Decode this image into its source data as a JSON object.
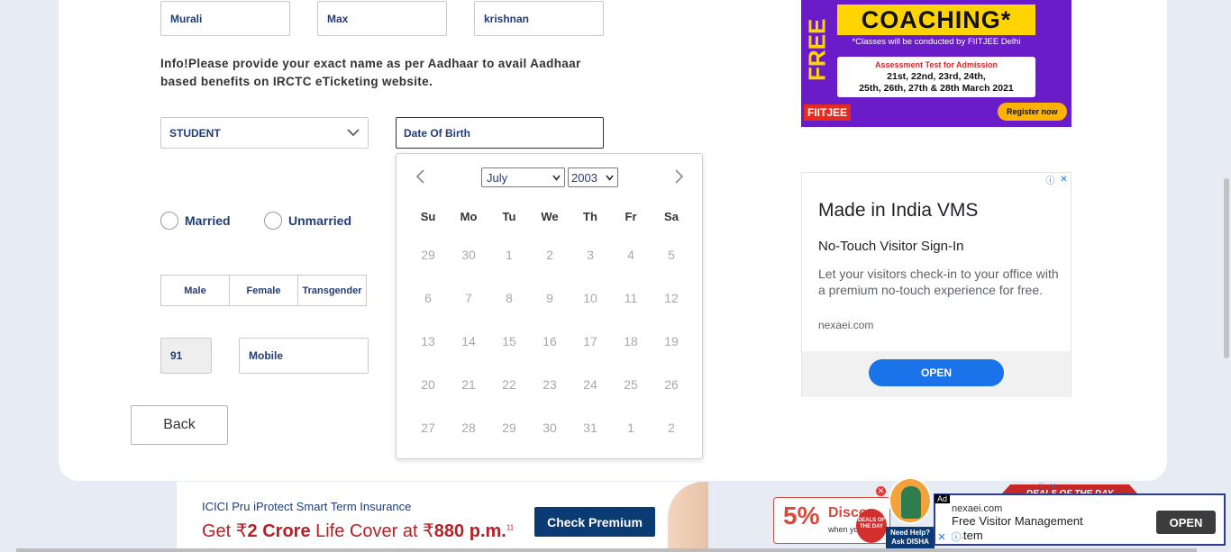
{
  "name_fields": {
    "first_name": "Murali",
    "middle_name": "Max",
    "last_name": "krishnan"
  },
  "info_text": "Info!Please provide your exact name as per Aadhaar to avail Aadhaar based benefits on IRCTC eTicketing website.",
  "occupation": {
    "selected": "STUDENT"
  },
  "dob": {
    "placeholder": "Date Of Birth"
  },
  "marital": {
    "married": "Married",
    "unmarried": "Unmarried"
  },
  "gender": {
    "male": "Male",
    "female": "Female",
    "transgender": "Transgender"
  },
  "phone": {
    "country_code": "91",
    "mobile_placeholder": "Mobile"
  },
  "back_label": "Back",
  "datepicker": {
    "month": "July",
    "year": "2003",
    "weekdays": [
      "Su",
      "Mo",
      "Tu",
      "We",
      "Th",
      "Fr",
      "Sa"
    ],
    "weeks": [
      [
        "29",
        "30",
        "1",
        "2",
        "3",
        "4",
        "5"
      ],
      [
        "6",
        "7",
        "8",
        "9",
        "10",
        "11",
        "12"
      ],
      [
        "13",
        "14",
        "15",
        "16",
        "17",
        "18",
        "19"
      ],
      [
        "20",
        "21",
        "22",
        "23",
        "24",
        "25",
        "26"
      ],
      [
        "27",
        "28",
        "29",
        "30",
        "31",
        "1",
        "2"
      ]
    ],
    "prev_icon": "chevron-left-icon",
    "next_icon": "chevron-right-icon"
  },
  "ad_fiitjee": {
    "free": "FREE",
    "coaching": "COACHING*",
    "note": "*Classes will be conducted by FIITJEE Delhi",
    "assessment": "Assessment Test for Admission",
    "dates_line1": "21st, 22nd, 23rd, 24th,",
    "dates_line2": "25th, 26th, 27th & 28th March 2021",
    "logo": "FIITJEE",
    "register": "Register now"
  },
  "ad_vms": {
    "title": "Made in India VMS",
    "subtitle": "No-Touch Visitor Sign-In",
    "description": "Let your visitors check-in to your office with a premium no-touch experience for free.",
    "domain": "nexaei.com",
    "open": "OPEN"
  },
  "banner_icici": {
    "line1": "ICICI Pru iProtect Smart Term Insurance",
    "line2_pre": "Get ₹",
    "line2_bold1": "2 Crore",
    "line2_mid": " Life Cover at ₹",
    "line2_bold2": "880 p.m.",
    "line2_sup": "11",
    "cta": "Check Premium"
  },
  "promo": {
    "percent": "5%",
    "word": "Disco",
    "sub": "when yo",
    "badge": "DEALS OF THE DAY"
  },
  "disha": {
    "label1": "Need Help?",
    "label2": "Ask DISHA"
  },
  "ad_bottom": {
    "ad_tag": "Ad",
    "deal_ribbon": "DEALS OF THE DAY",
    "domain": "nexaei.com",
    "title1": "Free Visitor Management",
    "title2": "ystem",
    "open": "OPEN"
  },
  "colors": {
    "text_blue": "#213d77",
    "ad_button": "#1a73e8",
    "fiitjee_purple": "#6a1cc9",
    "fiitjee_yellow": "#ffd400"
  }
}
